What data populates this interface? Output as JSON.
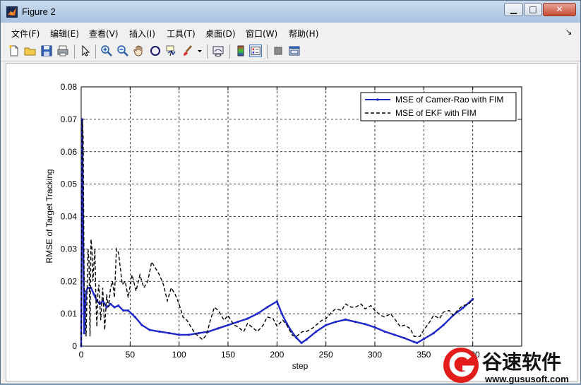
{
  "window": {
    "title": "Figure 2"
  },
  "menu": {
    "items": [
      {
        "id": "file",
        "label": "文件(F)"
      },
      {
        "id": "edit",
        "label": "编辑(E)"
      },
      {
        "id": "view",
        "label": "查看(V)"
      },
      {
        "id": "insert",
        "label": "插入(I)"
      },
      {
        "id": "tools",
        "label": "工具(T)"
      },
      {
        "id": "desktop",
        "label": "桌面(D)"
      },
      {
        "id": "window",
        "label": "窗口(W)"
      },
      {
        "id": "help",
        "label": "帮助(H)"
      }
    ]
  },
  "toolbar": {
    "icons": [
      "new-figure-icon",
      "open-icon",
      "save-icon",
      "print-icon",
      "pointer-icon",
      "zoom-in-icon",
      "zoom-out-icon",
      "pan-hand-icon",
      "rotate-3d-icon",
      "data-cursor-icon",
      "brush-icon",
      "brush-dropdown-icon",
      "link-plot-icon",
      "colorbar-icon",
      "legend-icon",
      "hide-plot-tools-icon",
      "show-plot-tools-icon"
    ]
  },
  "colors": {
    "series1": "#1f28c8",
    "series2": "#000000",
    "grid": "#000000"
  },
  "chart_data": {
    "type": "line",
    "title": "",
    "xlabel": "step",
    "ylabel": "RMSE of Target Tracking",
    "xlim": [
      0,
      450
    ],
    "ylim": [
      0,
      0.08
    ],
    "xticks": [
      "0",
      "50",
      "100",
      "150",
      "200",
      "250",
      "300",
      "350",
      "400"
    ],
    "yticks": [
      "0",
      "0.01",
      "0.02",
      "0.03",
      "0.04",
      "0.05",
      "0.06",
      "0.07",
      "0.08"
    ],
    "grid": true,
    "legend_position": "top-right",
    "series": [
      {
        "name": "MSE of Camer-Rao with FIM",
        "style": "solid-marker",
        "x": [
          0,
          1,
          3,
          5,
          7,
          10,
          13,
          16,
          19,
          22,
          26,
          30,
          34,
          38,
          43,
          48,
          55,
          62,
          70,
          80,
          90,
          100,
          110,
          120,
          130,
          140,
          150,
          160,
          170,
          180,
          190,
          200,
          205,
          210,
          215,
          220,
          225,
          230,
          240,
          250,
          260,
          270,
          280,
          290,
          300,
          310,
          320,
          330,
          340,
          343,
          350,
          360,
          370,
          380,
          390,
          400
        ],
        "y": [
          0.0,
          0.07,
          0.004,
          0.017,
          0.018,
          0.018,
          0.016,
          0.014,
          0.013,
          0.014,
          0.012,
          0.013,
          0.012,
          0.0125,
          0.011,
          0.011,
          0.009,
          0.0065,
          0.005,
          0.0045,
          0.004,
          0.0035,
          0.0035,
          0.004,
          0.0045,
          0.0055,
          0.0065,
          0.0075,
          0.0085,
          0.01,
          0.012,
          0.0138,
          0.01,
          0.007,
          0.0045,
          0.0025,
          0.001,
          0.002,
          0.0045,
          0.0065,
          0.0075,
          0.0082,
          0.0075,
          0.0068,
          0.0058,
          0.0045,
          0.0035,
          0.0025,
          0.0013,
          0.001,
          0.0022,
          0.004,
          0.0065,
          0.0095,
          0.0118,
          0.0145
        ]
      },
      {
        "name": "MSE of EKF with FIM",
        "style": "dashed",
        "x": [
          0,
          1,
          2,
          3,
          5,
          7,
          8,
          9,
          10,
          11,
          12,
          13,
          14,
          15,
          16,
          17,
          18,
          20,
          22,
          24,
          26,
          28,
          30,
          32,
          34,
          36,
          38,
          40,
          42,
          45,
          48,
          52,
          56,
          60,
          64,
          68,
          72,
          76,
          80,
          84,
          88,
          92,
          96,
          100,
          104,
          108,
          112,
          116,
          120,
          124,
          128,
          132,
          136,
          140,
          146,
          150,
          156,
          160,
          166,
          170,
          176,
          180,
          186,
          190,
          196,
          200,
          206,
          210,
          216,
          220,
          226,
          230,
          236,
          240,
          246,
          250,
          256,
          260,
          266,
          270,
          276,
          280,
          286,
          290,
          296,
          300,
          306,
          310,
          316,
          320,
          326,
          330,
          336,
          340,
          346,
          350,
          356,
          360,
          366,
          370,
          376,
          380,
          386,
          390,
          396,
          400
        ],
        "y": [
          0.0,
          0.07,
          0.065,
          0.018,
          0.003,
          0.03,
          0.026,
          0.003,
          0.033,
          0.03,
          0.02,
          0.025,
          0.03,
          0.015,
          0.006,
          0.016,
          0.019,
          0.008,
          0.018,
          0.005,
          0.016,
          0.012,
          0.018,
          0.02,
          0.015,
          0.03,
          0.029,
          0.024,
          0.019,
          0.02,
          0.015,
          0.022,
          0.017,
          0.022,
          0.018,
          0.02,
          0.026,
          0.024,
          0.022,
          0.019,
          0.014,
          0.018,
          0.016,
          0.013,
          0.009,
          0.008,
          0.006,
          0.004,
          0.003,
          0.002,
          0.0035,
          0.008,
          0.012,
          0.011,
          0.008,
          0.0095,
          0.0065,
          0.006,
          0.0045,
          0.007,
          0.0055,
          0.0045,
          0.0065,
          0.009,
          0.0085,
          0.0062,
          0.008,
          0.0065,
          0.0032,
          0.003,
          0.0045,
          0.0045,
          0.0055,
          0.0065,
          0.008,
          0.0085,
          0.0105,
          0.0115,
          0.011,
          0.013,
          0.012,
          0.012,
          0.013,
          0.0115,
          0.0125,
          0.011,
          0.0095,
          0.009,
          0.01,
          0.0085,
          0.006,
          0.0065,
          0.0055,
          0.003,
          0.003,
          0.005,
          0.0075,
          0.0095,
          0.0085,
          0.0105,
          0.011,
          0.0095,
          0.0115,
          0.0125,
          0.013,
          0.0145
        ]
      }
    ]
  },
  "watermark": {
    "brand": "谷速软件",
    "url": "www.gususoft.com"
  }
}
